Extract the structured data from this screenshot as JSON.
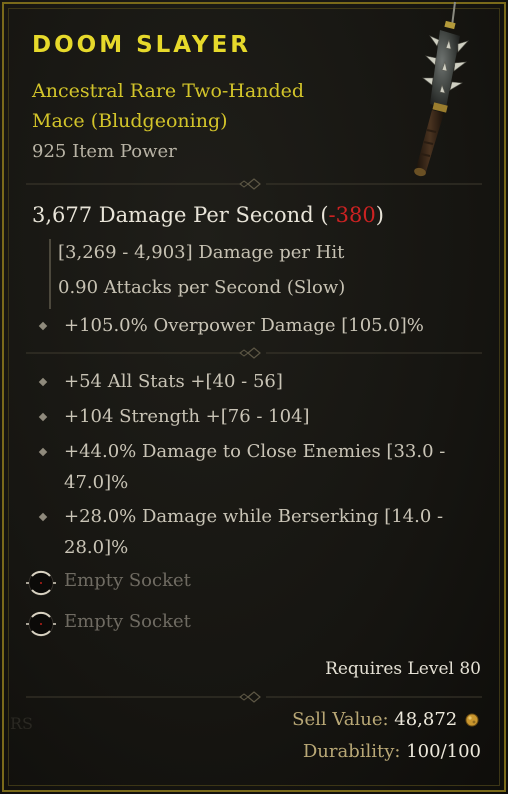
{
  "item": {
    "name": "DOOM SLAYER",
    "type_line": "Ancestral Rare Two-Handed Mace (Bludgeoning)",
    "item_power": "925 Item Power"
  },
  "damage": {
    "dps_label": "3,677 Damage Per Second",
    "dps_open": "(",
    "dps_delta": "-380",
    "dps_close": ")",
    "per_hit": "[3,269 - 4,903] Damage per Hit",
    "attacks": "0.90 Attacks per Second (Slow)"
  },
  "implicit": "+105.0% Overpower Damage [105.0]%",
  "affixes": [
    "+54 All Stats +[40 - 56]",
    "+104 Strength +[76 - 104]",
    "+44.0% Damage to Close Enemies [33.0 - 47.0]%",
    "+28.0% Damage while Berserking [14.0 - 28.0]%"
  ],
  "sockets": [
    "Empty Socket",
    "Empty Socket"
  ],
  "requirements": "Requires Level 80",
  "footer": {
    "sell_label": "Sell Value:",
    "sell_value": "48,872",
    "durability_label": "Durability:",
    "durability_value": "100/100"
  },
  "watermark_text": "RS",
  "colors": {
    "rare_yellow": "#e6d92b",
    "negative_red": "#cc2222",
    "frame_gold": "#7a6a1a"
  },
  "icons": [
    "mace-icon",
    "diamond-bullet-icon",
    "socket-icon",
    "gold-coin-icon"
  ]
}
